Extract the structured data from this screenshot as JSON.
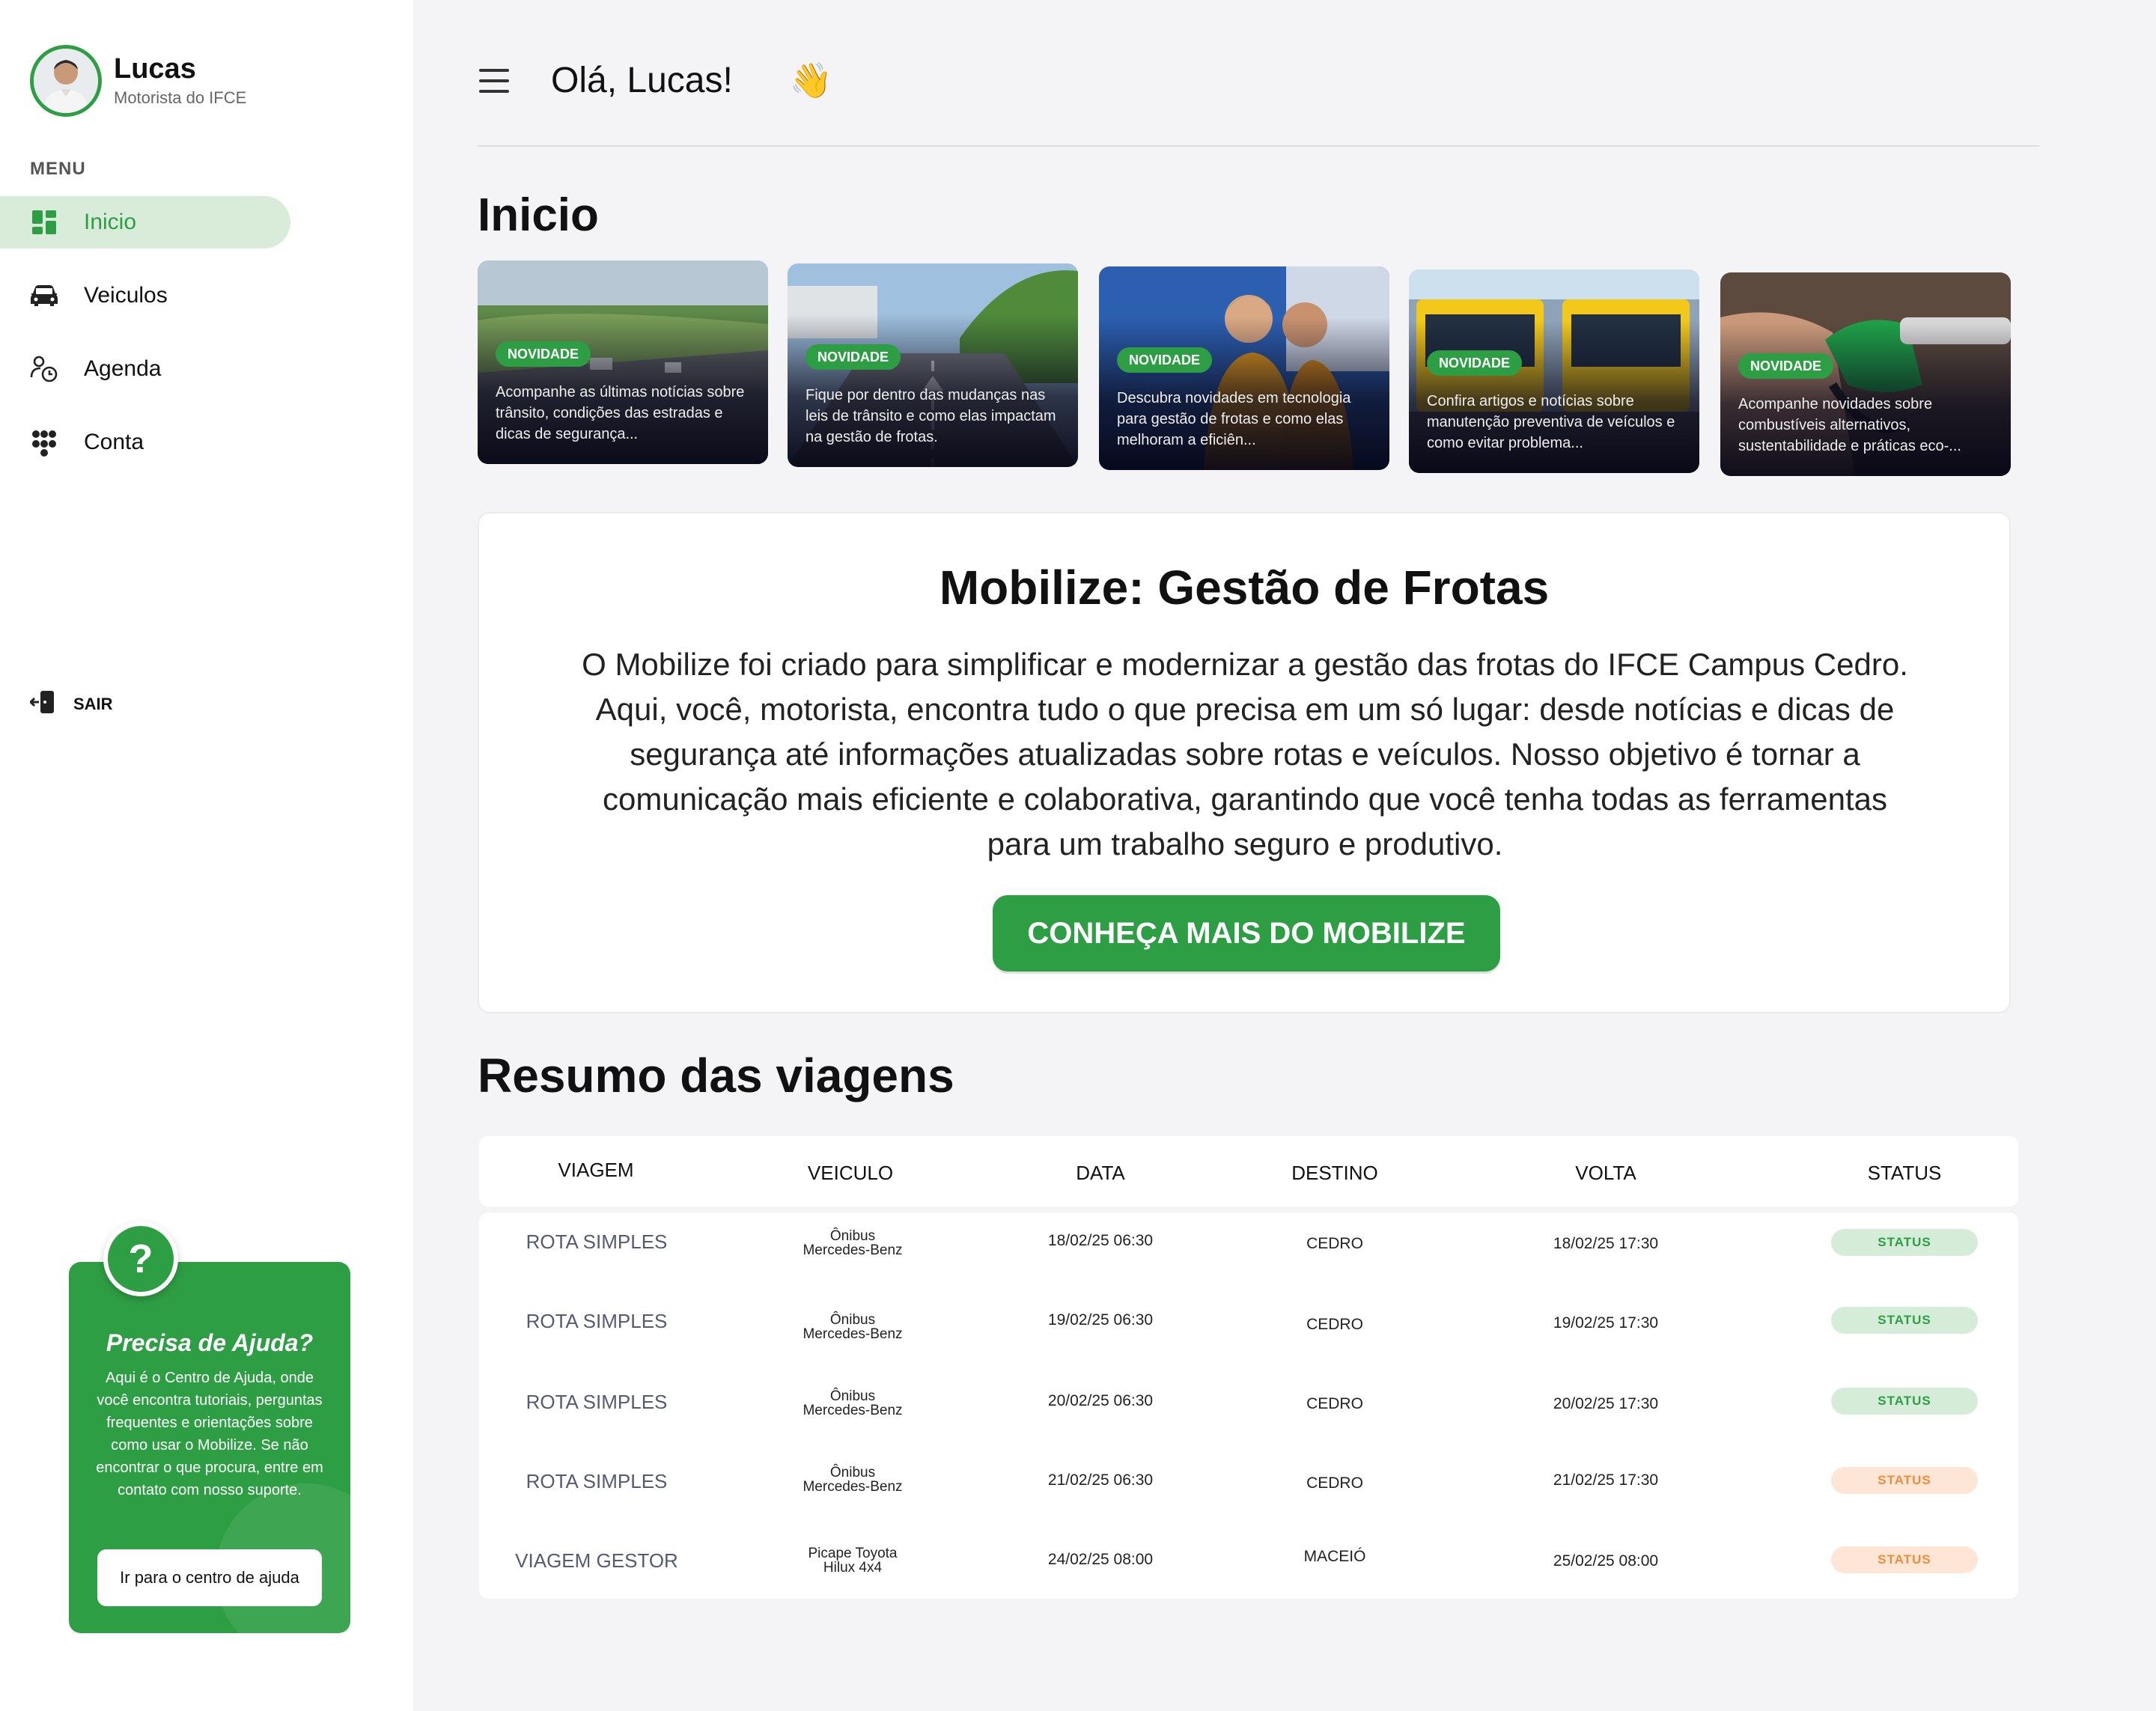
{
  "user": {
    "name": "Lucas",
    "role": "Motorista do IFCE"
  },
  "menu": {
    "label": "MENU",
    "items": [
      {
        "label": "Inicio",
        "icon": "dashboard-icon",
        "active": true
      },
      {
        "label": "Veiculos",
        "icon": "car-icon",
        "active": false
      },
      {
        "label": "Agenda",
        "icon": "schedule-icon",
        "active": false
      },
      {
        "label": "Conta",
        "icon": "account-icon",
        "active": false
      }
    ],
    "logout": "SAIR"
  },
  "help": {
    "icon_text": "?",
    "title": "Precisa de Ajuda?",
    "text": "Aqui é o Centro de Ajuda, onde você encontra tutoriais, perguntas frequentes e orientações sobre como usar o Mobilize. Se não encontrar o que procura, entre em contato com nosso suporte.",
    "button": "Ir para o centro de ajuda"
  },
  "header": {
    "greeting": "Olá, Lucas!",
    "emoji": "👋"
  },
  "page_title": "Inicio",
  "news": [
    {
      "badge": "NOVIDADE",
      "text": "Acompanhe as últimas notícias sobre trânsito, condições das estradas e dicas de segurança..."
    },
    {
      "badge": "NOVIDADE",
      "text": "Fique por dentro das mudanças nas leis de trânsito e como elas impactam na gestão de frotas."
    },
    {
      "badge": "NOVIDADE",
      "text": "Descubra novidades em tecnologia para gestão de frotas e como elas melhoram a eficiên..."
    },
    {
      "badge": "NOVIDADE",
      "text": "Confira artigos e notícias sobre manutenção preventiva de veículos e como evitar problema..."
    },
    {
      "badge": "NOVIDADE",
      "text": "Acompanhe novidades sobre combustíveis alternativos, sustentabilidade e práticas eco-..."
    }
  ],
  "about": {
    "title": "Mobilize: Gestão de Frotas",
    "text": "O Mobilize foi criado para simplificar e modernizar a gestão das frotas do IFCE Campus Cedro. Aqui, você, motorista, encontra tudo o que precisa em um só lugar: desde notícias e dicas de segurança até informações atualizadas sobre rotas e veículos. Nosso objetivo é tornar a comunicação mais eficiente e colaborativa, garantindo que você tenha todas as ferramentas para um trabalho seguro e produtivo.",
    "button": "CONHEÇA MAIS DO MOBILIZE"
  },
  "trips": {
    "title": "Resumo das viagens",
    "columns": [
      "VIAGEM",
      "VEICULO",
      "DATA",
      "DESTINO",
      "VOLTA",
      "STATUS"
    ],
    "rows": [
      {
        "trip": "ROTA SIMPLES",
        "vehicle_line1": "Ônibus",
        "vehicle_line2": "Mercedes-Benz",
        "date": "18/02/25 06:30",
        "destination": "CEDRO",
        "return": "18/02/25 17:30",
        "status": "STATUS",
        "status_color": "#2e9e44"
      },
      {
        "trip": "ROTA SIMPLES",
        "vehicle_line1": "Ônibus",
        "vehicle_line2": "Mercedes-Benz",
        "date": "19/02/25 06:30",
        "destination": "CEDRO",
        "return": "19/02/25 17:30",
        "status": "STATUS",
        "status_color": "#2e9e44"
      },
      {
        "trip": "ROTA SIMPLES",
        "vehicle_line1": "Ônibus",
        "vehicle_line2": "Mercedes-Benz",
        "date": "20/02/25 06:30",
        "destination": "CEDRO",
        "return": "20/02/25 17:30",
        "status": "STATUS",
        "status_color": "#2e9e44"
      },
      {
        "trip": "ROTA SIMPLES",
        "vehicle_line1": "Ônibus",
        "vehicle_line2": "Mercedes-Benz",
        "date": "21/02/25 06:30",
        "destination": "CEDRO",
        "return": "21/02/25 17:30",
        "status": "STATUS",
        "status_color": "#f08c3a"
      },
      {
        "trip": "VIAGEM GESTOR",
        "vehicle_line1": "Picape Toyota",
        "vehicle_line2": "Hilux 4x4",
        "date": "24/02/25 08:00",
        "destination": "MACEIÓ",
        "return": "25/02/25 08:00",
        "status": "STATUS",
        "status_color": "#f08c3a"
      }
    ]
  },
  "colors": {
    "accent": "#2e9e44",
    "active_bg": "#d8ecd9",
    "warning": "#f08c3a",
    "background": "#f4f4f6"
  }
}
